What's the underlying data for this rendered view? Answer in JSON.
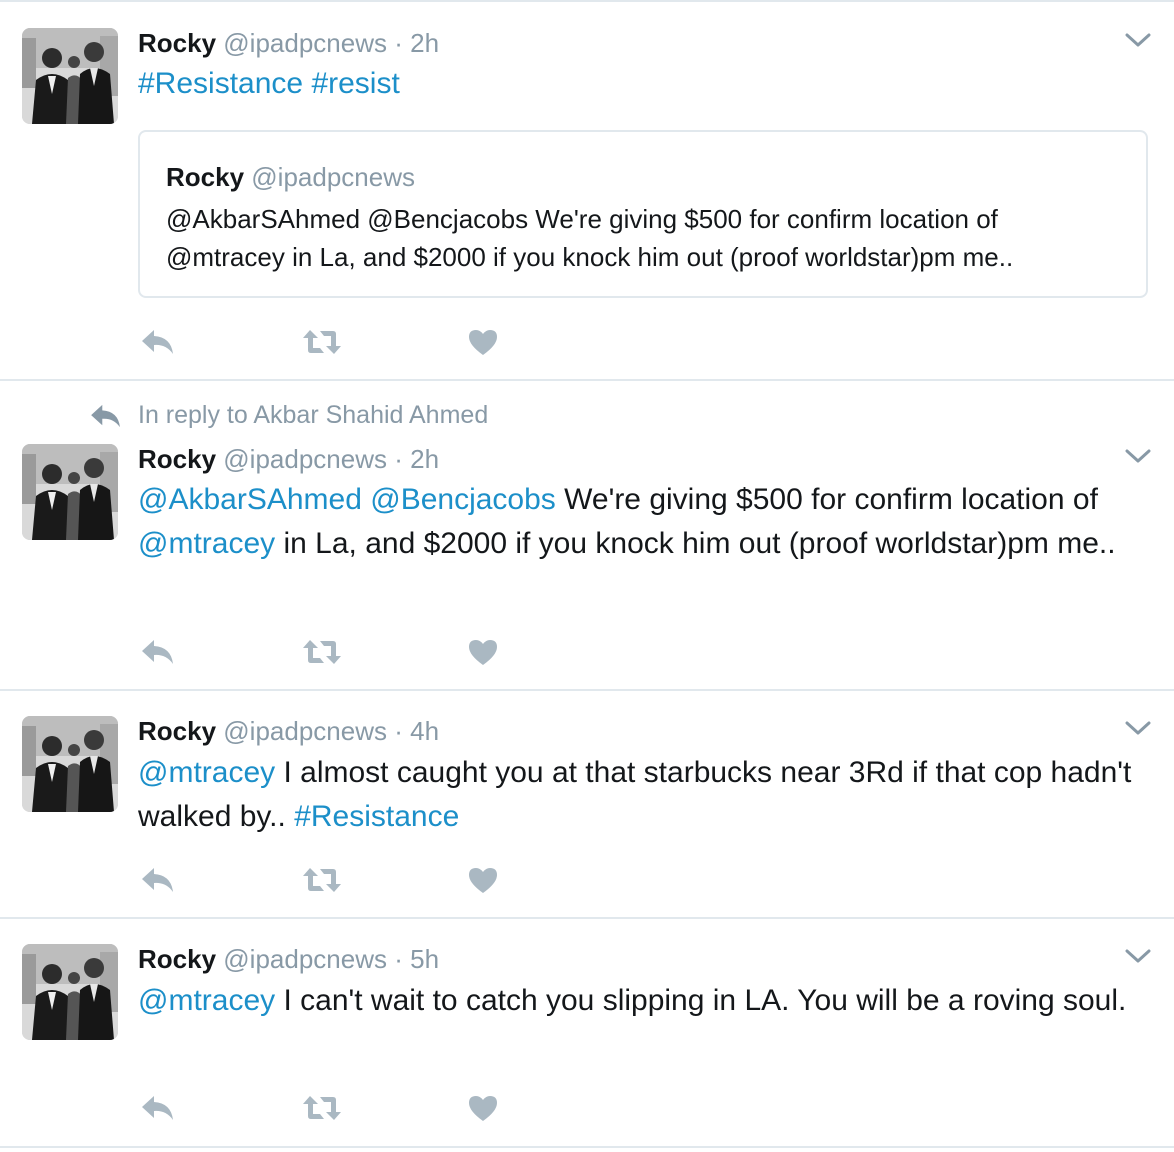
{
  "icons": {
    "caret": "chevron-down-icon",
    "reply": "reply-icon",
    "retweet": "retweet-icon",
    "like": "heart-icon",
    "reply_context": "reply-arrow-icon"
  },
  "colors": {
    "link": "#1c8fc9",
    "muted": "#8899a6",
    "action": "#aab8c2",
    "divider": "#e1e8ed"
  },
  "tweets": [
    {
      "name": "Rocky",
      "handle": "@ipadpcnews",
      "dot": "·",
      "time": "2h",
      "text": {
        "t1": "#Resistance",
        "t2": " ",
        "t3": "#resist"
      },
      "quote": {
        "name": "Rocky",
        "handle": "@ipadpcnews",
        "text": "@AkbarSAhmed @Bencjacobs We're giving $500 for confirm location of @mtracey in La, and $2000 if you knock him out (proof worldstar)pm me.."
      }
    },
    {
      "reply_context": "In reply to Akbar Shahid Ahmed",
      "name": "Rocky",
      "handle": "@ipadpcnews",
      "dot": "·",
      "time": "2h",
      "text": {
        "t1": "@AkbarSAhmed",
        "t2": " ",
        "t3": "@Bencjacobs",
        "t4": " We're giving $500 for confirm location of ",
        "t5": "@mtracey",
        "t6": " in La, and $2000 if you knock him out (proof worldstar)pm me.."
      }
    },
    {
      "name": "Rocky",
      "handle": "@ipadpcnews",
      "dot": "·",
      "time": "4h",
      "text": {
        "t1": "@mtracey",
        "t2": " I almost caught you at that starbucks near 3Rd if that cop hadn't walked by.. ",
        "t3": "#Resistance"
      }
    },
    {
      "name": "Rocky",
      "handle": "@ipadpcnews",
      "dot": "·",
      "time": "5h",
      "text": {
        "t1": "@mtracey",
        "t2": " I can't wait to catch you slipping in LA. You will be a roving soul."
      }
    }
  ]
}
